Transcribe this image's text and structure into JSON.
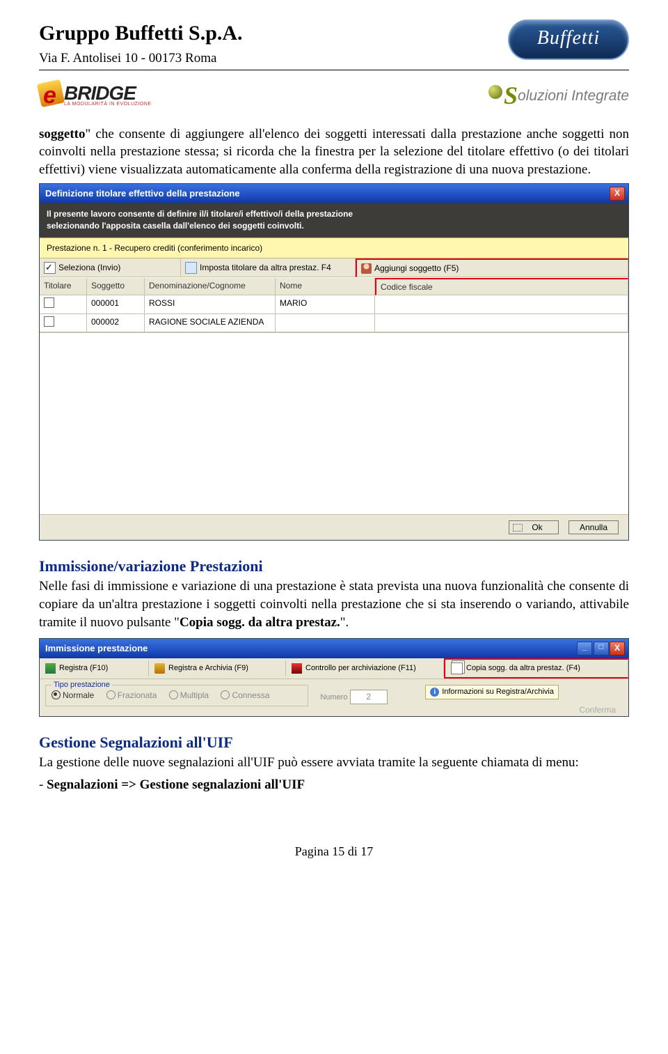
{
  "header": {
    "company": "Gruppo Buffetti S.p.A.",
    "address": "Via F. Antolisei 10 - 00173 Roma",
    "brand_logo_text": "Buffetti"
  },
  "logos": {
    "ebridge_e": "e",
    "ebridge_text": "BRIDGE",
    "ebridge_sub": "LA MODULARITÀ IN EVOLUZIONE",
    "soluzioni_s": "S",
    "soluzioni_rest": "oluzioni Integrate"
  },
  "para1_a": "soggetto",
  "para1_b": "\" che consente di aggiungere all'elenco dei soggetti interessati dalla prestazione anche soggetti non coinvolti nella prestazione stessa; si ricorda che la finestra per la selezione del titolare effettivo (o dei titolari effettivi) viene visualizzata automaticamente alla conferma della registrazione di una nuova prestazione.",
  "win1": {
    "title": "Definizione titolare effettivo della prestazione",
    "close": "X",
    "intro1": "Il presente lavoro consente di definire il/i titolare/i effettivo/i della prestazione",
    "intro2": "selezionando l'apposita casella dall'elenco dei soggetti coinvolti.",
    "yellow": "Prestazione n. 1 - Recupero crediti (conferimento incarico)",
    "tb": {
      "seleziona": "Seleziona (Invio)",
      "imposta": "Imposta titolare da altra prestaz. F4",
      "aggiungi": "Aggiungi soggetto (F5)"
    },
    "cols": {
      "titolare": "Titolare",
      "soggetto": "Soggetto",
      "denom": "Denominazione/Cognome",
      "nome": "Nome",
      "cf": "Codice fiscale"
    },
    "rows": [
      {
        "sogg": "000001",
        "den": "ROSSI",
        "nome": "MARIO"
      },
      {
        "sogg": "000002",
        "den": "RAGIONE SOCIALE AZIENDA",
        "nome": ""
      }
    ],
    "ok": "Ok",
    "annulla": "Annulla"
  },
  "sec2": {
    "title": "Immissione/variazione Prestazioni",
    "body_a": "Nelle fasi di immissione e variazione di una prestazione è stata prevista una nuova funzionalità che consente di copiare da un'altra prestazione i soggetti coinvolti nella prestazione che si sta inserendo o variando, attivabile tramite il nuovo pulsante \"",
    "body_b": "Copia sogg. da altra prestaz.",
    "body_c": "\"."
  },
  "win2": {
    "title": "Immissione prestazione",
    "tb": {
      "registra": "Registra (F10)",
      "registra_arch": "Registra e Archivia (F9)",
      "controllo": "Controllo per archiviazione (F11)",
      "copia": "Copia sogg. da altra prestaz. (F4)"
    },
    "group_label": "Tipo prestazione",
    "radios": {
      "normale": "Normale",
      "fraz": "Frazionata",
      "mult": "Multipla",
      "conn": "Connessa"
    },
    "numero_label": "Numero",
    "numero_val": "2",
    "info": "Informazioni su Registra/Archivia",
    "conferma": "Conferma"
  },
  "sec3": {
    "title": "Gestione Segnalazioni all'UIF",
    "body": "La gestione delle nuove segnalazioni all'UIF può essere avviata tramite la seguente chiamata di menu:",
    "bullet_a": "- ",
    "bullet_b": "Segnalazioni => Gestione segnalazioni all'UIF"
  },
  "footer": "Pagina 15 di 17"
}
